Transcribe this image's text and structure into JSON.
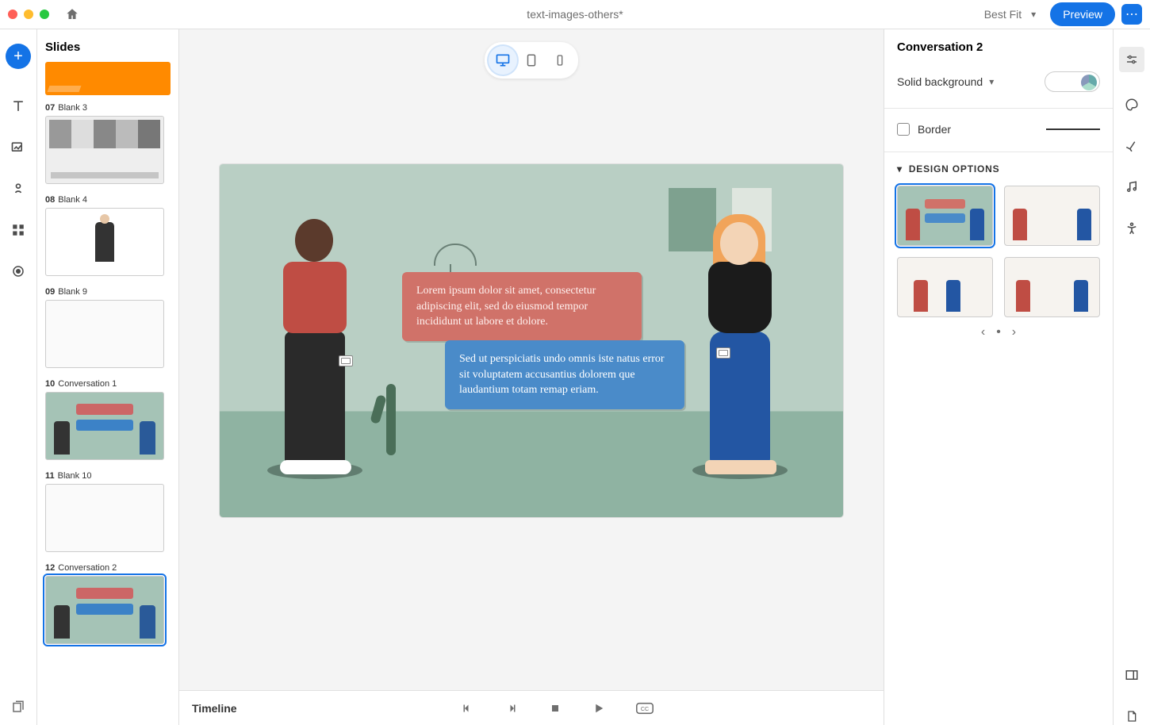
{
  "titlebar": {
    "document_title": "text-images-others*",
    "zoom": "Best Fit",
    "preview_label": "Preview"
  },
  "slides": {
    "panel_title": "Slides",
    "items": [
      {
        "num": "07",
        "name": "Blank 3"
      },
      {
        "num": "08",
        "name": "Blank 4"
      },
      {
        "num": "09",
        "name": "Blank 9"
      },
      {
        "num": "10",
        "name": "Conversation 1"
      },
      {
        "num": "11",
        "name": "Blank 10"
      },
      {
        "num": "12",
        "name": "Conversation 2"
      }
    ]
  },
  "canvas": {
    "bubble1": "Lorem ipsum dolor sit amet, consectetur adipiscing elit, sed do eiusmod tempor incididunt ut labore et dolore.",
    "bubble2": "Sed ut perspiciatis undo omnis iste natus error sit voluptatem accusantius dolorem que laudantium totam remap eriam."
  },
  "timeline": {
    "title": "Timeline"
  },
  "props": {
    "title": "Conversation 2",
    "bg_label": "Solid background",
    "border_label": "Border",
    "design_options_label": "DESIGN OPTIONS"
  }
}
